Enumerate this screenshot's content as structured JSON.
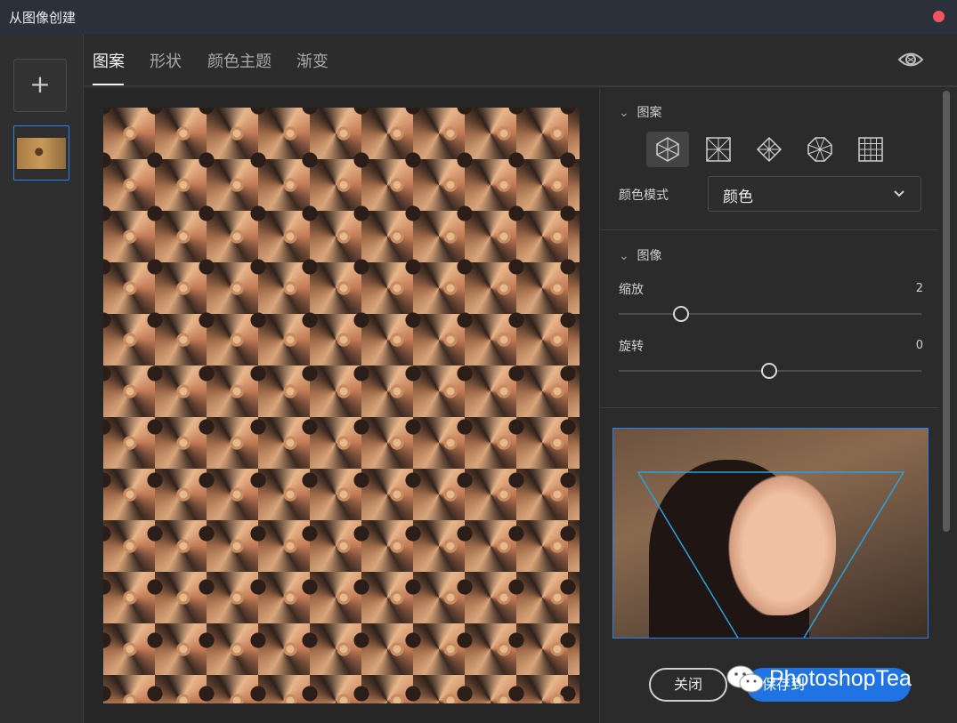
{
  "window": {
    "title": "从图像创建"
  },
  "tabs": [
    {
      "label": "图案",
      "active": true
    },
    {
      "label": "形状",
      "active": false
    },
    {
      "label": "颜色主题",
      "active": false
    },
    {
      "label": "渐变",
      "active": false
    }
  ],
  "sidebar": {
    "add_label": "+"
  },
  "pattern_section": {
    "header": "图案",
    "shape_icons": [
      "hexagon-pattern-icon",
      "square-grid-diagonal-icon",
      "diamond-star-icon",
      "octagon-pattern-icon",
      "grid-icon"
    ],
    "selected_shape": "hexagon-pattern-icon",
    "color_mode_label": "颜色模式",
    "color_mode_value": "颜色"
  },
  "image_section": {
    "header": "图像",
    "scale_label": "缩放",
    "scale_value": "2",
    "rotate_label": "旋转",
    "rotate_value": "0"
  },
  "actions": {
    "close_label": "关闭",
    "save_label": "保存到"
  },
  "watermark": {
    "text": "PhotoshopTea"
  },
  "colors": {
    "accent": "#1f73e2",
    "close_dot": "#f1545f",
    "selection_border": "#2d7ff0"
  }
}
